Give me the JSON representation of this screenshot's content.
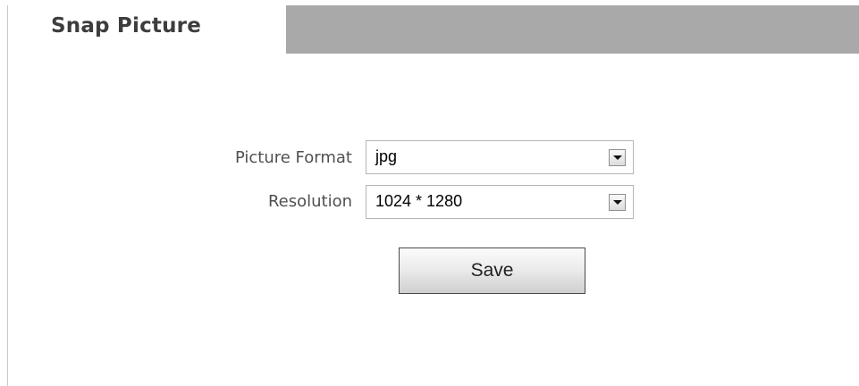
{
  "tab": {
    "title": "Snap Picture"
  },
  "form": {
    "picture_format": {
      "label": "Picture Format",
      "value": "jpg"
    },
    "resolution": {
      "label": "Resolution",
      "value": "1024 * 1280"
    },
    "save_label": "Save"
  },
  "colors": {
    "tabbar_background": "#a9a9a9",
    "tab_text": "#3d3d3d",
    "label_text": "#505050"
  },
  "icons": {
    "dropdown": "chevron-down-icon"
  }
}
